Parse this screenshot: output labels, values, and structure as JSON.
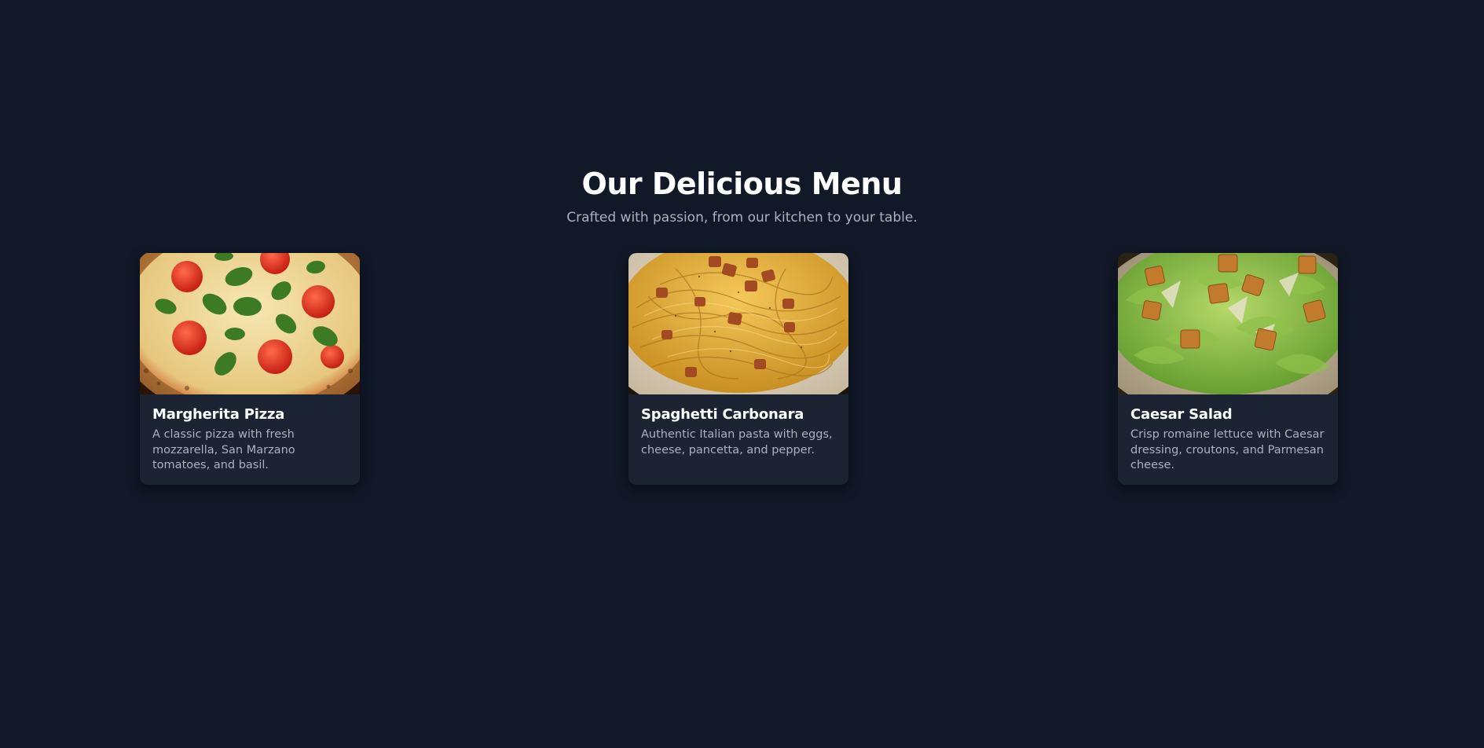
{
  "header": {
    "title": "Our Delicious Menu",
    "subtitle": "Crafted with passion, from our kitchen to your table."
  },
  "menu": {
    "items": [
      {
        "name": "Margherita Pizza",
        "description": "A classic pizza with fresh mozzarella, San Marzano tomatoes, and basil.",
        "image_icon": "pizza-image"
      },
      {
        "name": "Spaghetti Carbonara",
        "description": "Authentic Italian pasta with eggs, cheese, pancetta, and pepper.",
        "image_icon": "pasta-image"
      },
      {
        "name": "Caesar Salad",
        "description": "Crisp romaine lettuce with Caesar dressing, croutons, and Parmesan cheese.",
        "image_icon": "salad-image"
      }
    ]
  },
  "colors": {
    "background": "#111827",
    "card": "#1c2332",
    "title_text": "#ffffff",
    "muted_text": "#aab2c0"
  }
}
